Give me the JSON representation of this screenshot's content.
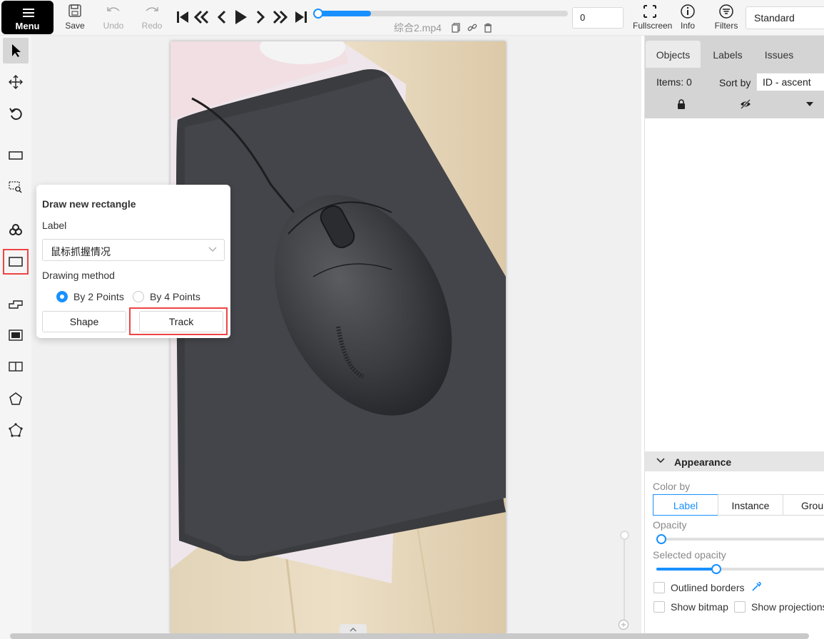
{
  "topbar": {
    "menu_label": "Menu",
    "save_label": "Save",
    "undo_label": "Undo",
    "redo_label": "Redo",
    "filename": "综合2.mp4",
    "frame_value": "0",
    "timeline_progress": 0.22,
    "fullscreen_label": "Fullscreen",
    "info_label": "Info",
    "filters_label": "Filters",
    "workspace": "Standard"
  },
  "popover": {
    "title": "Draw new rectangle",
    "label_caption": "Label",
    "label_value": "鼠标抓握情况",
    "method_caption": "Drawing method",
    "option_2pts": "By 2 Points",
    "option_4pts": "By 4 Points",
    "selected_option": "By 2 Points",
    "shape_label": "Shape",
    "track_label": "Track"
  },
  "sidebar": {
    "tabs": [
      "Objects",
      "Labels",
      "Issues"
    ],
    "active_tab": "Objects",
    "items_count": "Items: 0",
    "sort_by_label": "Sort by",
    "sort_value": "ID - ascent"
  },
  "appearance": {
    "header": "Appearance",
    "color_by_label": "Color by",
    "color_by_options": [
      "Label",
      "Instance",
      "Group"
    ],
    "color_by_selected": "Label",
    "opacity_label": "Opacity",
    "opacity_value": 0.03,
    "selected_opacity_label": "Selected opacity",
    "selected_opacity_value": 0.35,
    "outlined_borders_label": "Outlined borders",
    "show_bitmap_label": "Show bitmap",
    "show_projections_label": "Show projections"
  },
  "colors": {
    "accent": "#1890ff",
    "highlight": "#ef4444",
    "menu_bg": "#000000"
  }
}
